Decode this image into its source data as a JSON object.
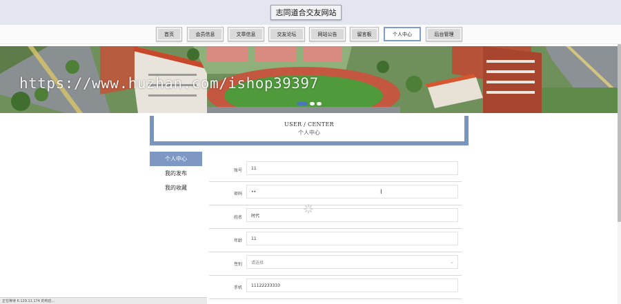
{
  "site": {
    "title": "志同道合交友网站"
  },
  "nav": {
    "items": [
      {
        "label": "首页"
      },
      {
        "label": "会员信息"
      },
      {
        "label": "文章信息"
      },
      {
        "label": "交友论坛"
      },
      {
        "label": "网站公告"
      },
      {
        "label": "留言板"
      },
      {
        "label": "个人中心",
        "active": true
      },
      {
        "label": "后台管理"
      }
    ]
  },
  "banner": {
    "watermark": "https://www.huzhan.com/ishop39397",
    "slide_count": 3,
    "active_slide": 1
  },
  "section": {
    "title_en": "USER / CENTER",
    "title_cn": "个人中心"
  },
  "sidebar": {
    "items": [
      {
        "label": "个人中心",
        "active": true
      },
      {
        "label": "我的发布"
      },
      {
        "label": "我的收藏"
      }
    ]
  },
  "form": {
    "fields": [
      {
        "label": "账号",
        "value": "11"
      },
      {
        "label": "密码",
        "value": "••"
      },
      {
        "label": "姓名",
        "value": "时代"
      },
      {
        "label": "年龄",
        "value": "11"
      },
      {
        "label": "性别",
        "value": "请选择",
        "type": "select"
      },
      {
        "label": "手机",
        "value": "11122233333"
      }
    ]
  },
  "status_bar": {
    "text": "正在等待 6.129.11.174 的响应..."
  },
  "colors": {
    "accent": "#7c98c3",
    "nav_active_border": "#7f9bc6",
    "topbar": "#e3e6ee"
  }
}
